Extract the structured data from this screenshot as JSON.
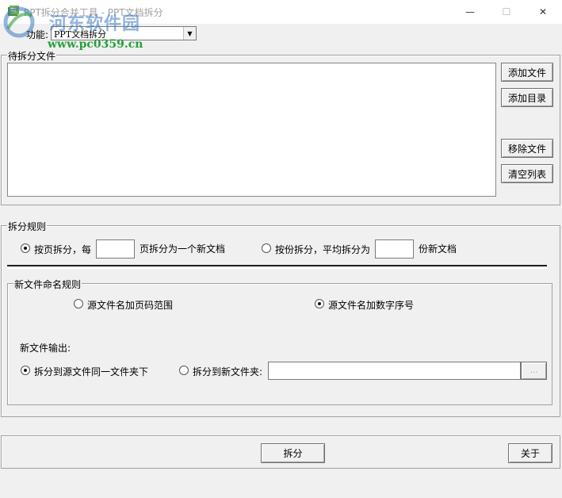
{
  "window": {
    "title": "PPT拆分合并工具 - PPT文档拆分",
    "minimize_glyph": "—",
    "maximize_glyph": "☐",
    "close_glyph": "✕"
  },
  "watermark": {
    "name": "河东软件园",
    "url": "www.pc0359.cn"
  },
  "function": {
    "label": "功能:",
    "selected": "PPT文档拆分"
  },
  "files_group": {
    "label": "待拆分文件",
    "items": [],
    "add_file": "添加文件",
    "add_dir": "添加目录",
    "remove_file": "移除文件",
    "clear_list": "清空列表"
  },
  "split_rules": {
    "label": "拆分规则",
    "by_page_label": "按页拆分，每",
    "by_page_suffix": "页拆分为一个新文档",
    "by_page_value": "",
    "by_count_label": "按份拆分，平均拆分为",
    "by_count_suffix": "份新文档",
    "by_count_value": "",
    "selected": "by_page"
  },
  "naming": {
    "label": "新文件命名规则",
    "page_range": "源文件名加页码范围",
    "number_seq": "源文件名加数字序号",
    "selected": "number_seq"
  },
  "output": {
    "label": "新文件输出:",
    "same_folder": "拆分到源文件同一文件夹下",
    "new_folder": "拆分到新文件夹:",
    "folder_value": "",
    "browse": "...",
    "selected": "same_folder"
  },
  "actions": {
    "split": "拆分",
    "about": "关于"
  },
  "colors": {
    "watermark_blue": "#3a78c3",
    "watermark_green": "#27a03a",
    "window_bg": "#f0f0f0"
  }
}
